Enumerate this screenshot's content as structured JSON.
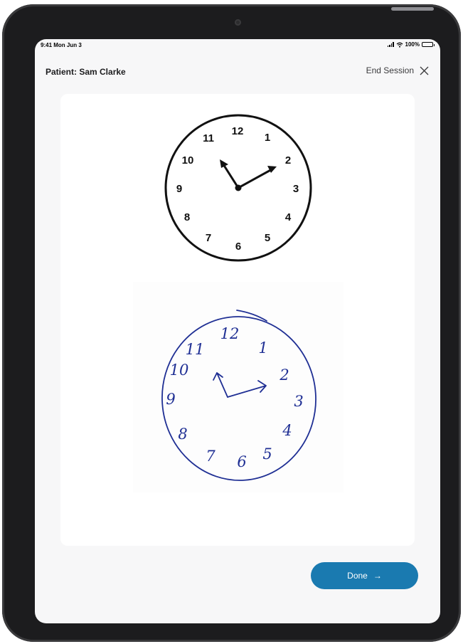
{
  "status_bar": {
    "time": "9:41 Mon Jun 3",
    "battery": "100%"
  },
  "header": {
    "patient_label": "Patient: Sam Clarke",
    "end_session_label": "End Session"
  },
  "reference_clock": {
    "numerals": [
      "12",
      "1",
      "2",
      "3",
      "4",
      "5",
      "6",
      "7",
      "8",
      "9",
      "10",
      "11"
    ]
  },
  "drawn_clock": {
    "numerals": [
      "12",
      "1",
      "2",
      "3",
      "4",
      "5",
      "6",
      "7",
      "8",
      "9",
      "10",
      "11"
    ]
  },
  "footer": {
    "done_label": "Done",
    "done_arrow": "→"
  },
  "colors": {
    "accent": "#1a7ab0",
    "ink": "#1f2f94"
  }
}
